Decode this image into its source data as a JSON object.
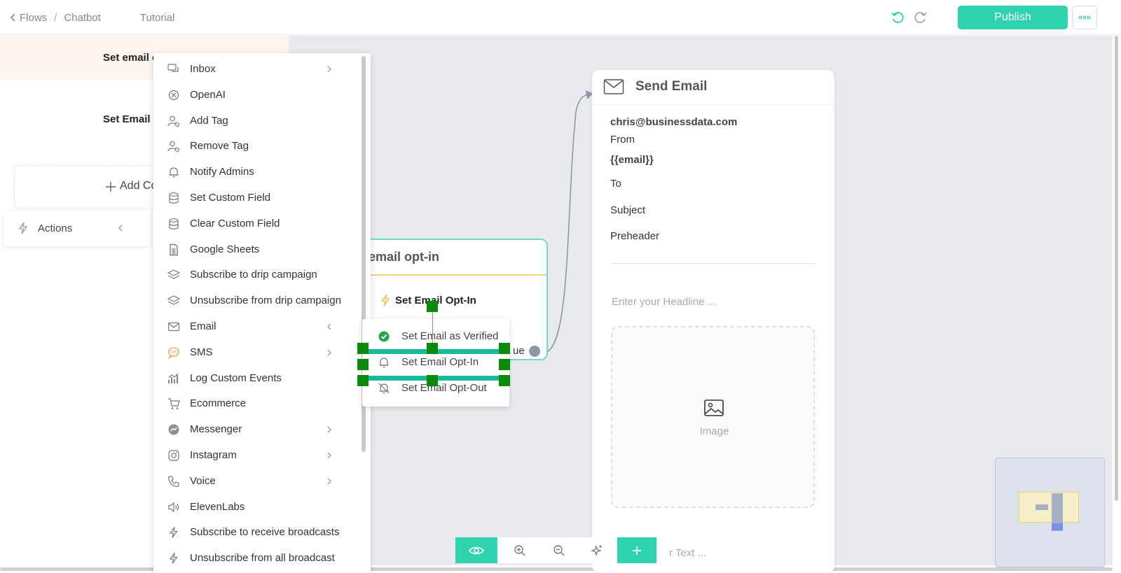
{
  "breadcrumb": {
    "flows": "Flows",
    "chatbot": "Chatbot",
    "tutorial": "Tutorial"
  },
  "header": {
    "publish_label": "Publish"
  },
  "sidebar": {
    "row1_label": "Set email o",
    "row2_label": "Set Email",
    "add_condition_label": "Add Co",
    "actions_label": "Actions"
  },
  "menu": {
    "items": [
      {
        "label": "Inbox",
        "icon": "chat-icon"
      },
      {
        "label": "OpenAI",
        "icon": "openai-icon"
      },
      {
        "label": "Add Tag",
        "icon": "user-tag-icon"
      },
      {
        "label": "Remove Tag",
        "icon": "user-tag-icon"
      },
      {
        "label": "Notify Admins",
        "icon": "bell-icon"
      },
      {
        "label": "Set Custom Field",
        "icon": "database-icon"
      },
      {
        "label": "Clear Custom Field",
        "icon": "database-icon"
      },
      {
        "label": "Google Sheets",
        "icon": "sheet-icon"
      },
      {
        "label": "Subscribe to drip campaign",
        "icon": "layers-icon"
      },
      {
        "label": "Unsubscribe from drip campaign",
        "icon": "layers-icon"
      },
      {
        "label": "Email",
        "icon": "mail-icon"
      },
      {
        "label": "SMS",
        "icon": "sms-icon"
      },
      {
        "label": "Log Custom Events",
        "icon": "chart-icon"
      },
      {
        "label": "Ecommerce",
        "icon": "cart-icon"
      },
      {
        "label": "Messenger",
        "icon": "messenger-icon"
      },
      {
        "label": "Instagram",
        "icon": "instagram-icon"
      },
      {
        "label": "Voice",
        "icon": "phone-icon"
      },
      {
        "label": "ElevenLabs",
        "icon": "speaker-icon"
      },
      {
        "label": "Subscribe to receive broadcasts",
        "icon": "bolt-icon"
      },
      {
        "label": "Unsubscribe from all broadcast",
        "icon": "bolt-icon"
      }
    ]
  },
  "node": {
    "title": "email opt-in",
    "action": "Set Email Opt-In",
    "continue_label": "ue"
  },
  "submenu": {
    "items": [
      {
        "label": "Set Email as Verified",
        "icon": "check-circle-icon"
      },
      {
        "label": "Set Email Opt-In",
        "icon": "bell-icon"
      },
      {
        "label": "Set Email Opt-Out",
        "icon": "bell-off-icon"
      }
    ]
  },
  "email_card": {
    "title": "Send Email",
    "from_value": "chris@businessdata.com",
    "from_label": "From",
    "to_value": "{{email}}",
    "to_label": "To",
    "subject_label": "Subject",
    "preheader_label": "Preheader",
    "headline_placeholder": "Enter your Headline ...",
    "image_label": "Image",
    "text_placeholder": "r Text ..."
  },
  "colors": {
    "accent": "#2fd3b0",
    "node_border": "#6fdcc5",
    "selection": "#19b99a",
    "handle": "#0a8a0a"
  }
}
